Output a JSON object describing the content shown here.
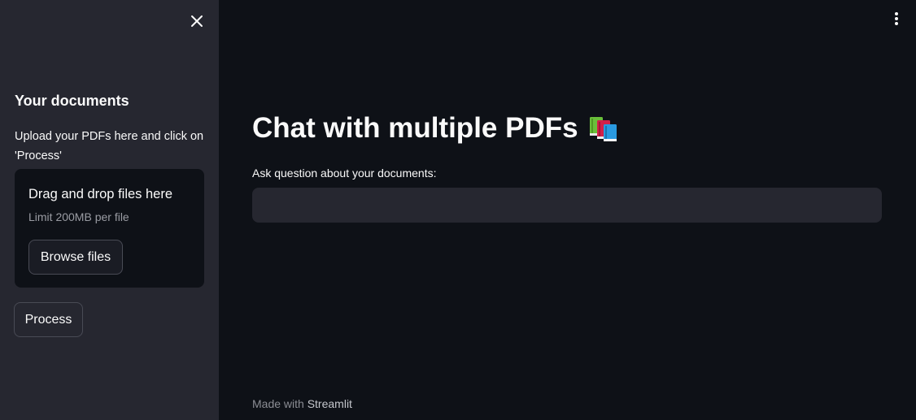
{
  "sidebar": {
    "heading": "Your documents",
    "description": "Upload your PDFs here and click on 'Process'",
    "uploader": {
      "title": "Drag and drop files here",
      "limit": "Limit 200MB per file",
      "browse_label": "Browse files"
    },
    "process_label": "Process",
    "close_icon": "close-icon"
  },
  "main": {
    "title": "Chat with multiple PDFs",
    "title_icon": "books-icon",
    "input_label": "Ask question about your documents:",
    "input_value": "",
    "menu_icon": "kebab-menu-icon"
  },
  "footer": {
    "prefix": "Made with",
    "brand": "Streamlit"
  },
  "colors": {
    "background": "#0e1117",
    "sidebar": "#262730",
    "text": "#fafafa",
    "muted": "#9a9ca3",
    "border": "#494b55"
  }
}
